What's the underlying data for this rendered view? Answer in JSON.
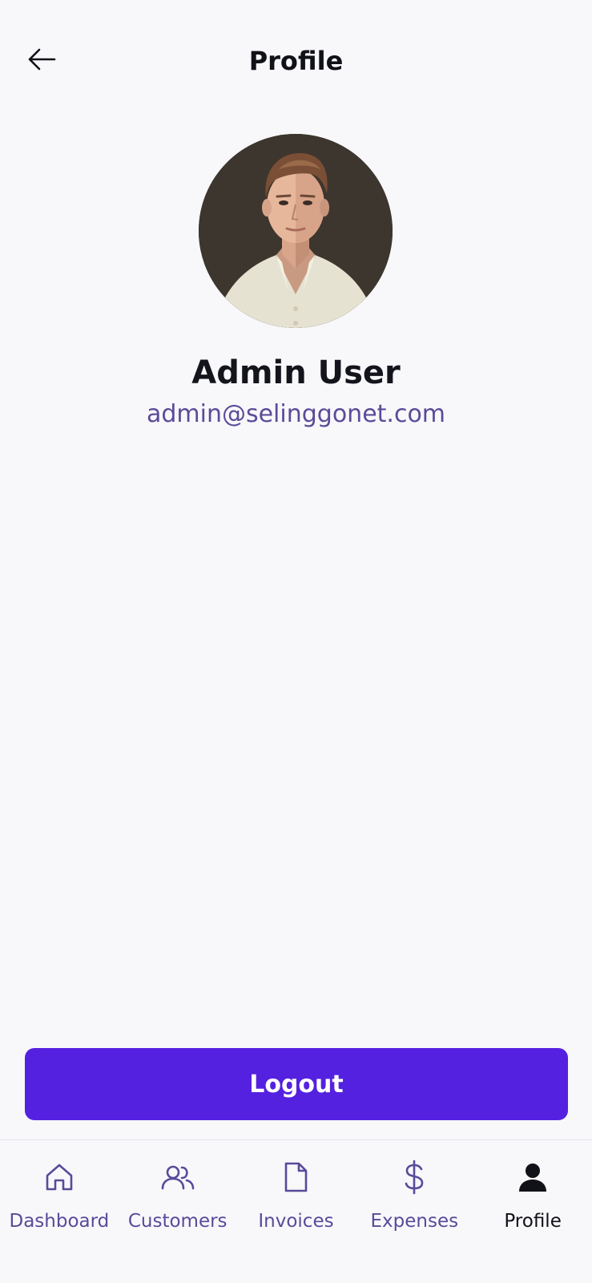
{
  "header": {
    "title": "Profile",
    "back_icon": "arrow-left-icon"
  },
  "profile": {
    "name": "Admin User",
    "email": "admin@selinggonet.com",
    "avatar_icon": "avatar-portrait"
  },
  "actions": {
    "logout_label": "Logout"
  },
  "bottom_nav": {
    "items": [
      {
        "label": "Dashboard",
        "icon": "home-icon",
        "active": false
      },
      {
        "label": "Customers",
        "icon": "users-icon",
        "active": false
      },
      {
        "label": "Invoices",
        "icon": "file-icon",
        "active": false
      },
      {
        "label": "Expenses",
        "icon": "dollar-icon",
        "active": false
      },
      {
        "label": "Profile",
        "icon": "user-filled-icon",
        "active": true
      }
    ]
  },
  "colors": {
    "background": "#f8f8fb",
    "accent": "#5521e0",
    "secondary_text": "#5a4a9a",
    "primary_text": "#111118"
  }
}
